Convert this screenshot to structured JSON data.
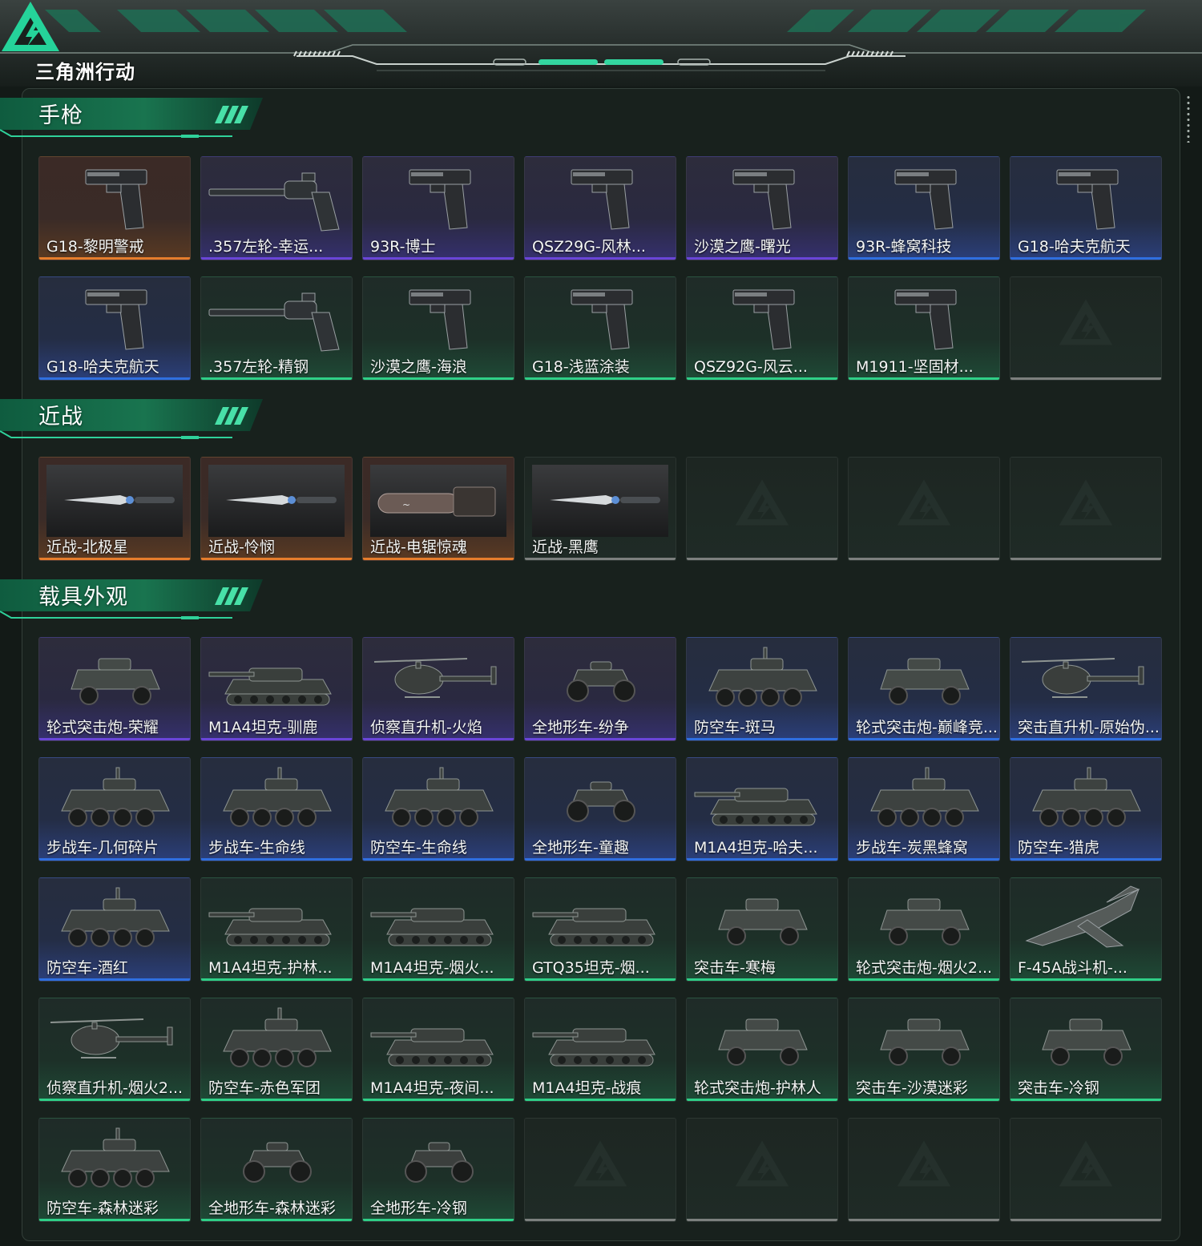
{
  "header": {
    "logo_text": "三角洲行动",
    "accent": "#2fd19a"
  },
  "sections": [
    {
      "title": "手枪",
      "cards": [
        {
          "label": "G18-黎明警戒",
          "rarity": "orange",
          "icon": "pistol-icon"
        },
        {
          "label": ".357左轮-幸运...",
          "rarity": "purple",
          "icon": "revolver-icon"
        },
        {
          "label": "93R-博士",
          "rarity": "purple",
          "icon": "pistol-icon"
        },
        {
          "label": "QSZ29G-风林...",
          "rarity": "purple",
          "icon": "pistol-icon"
        },
        {
          "label": "沙漠之鹰-曙光",
          "rarity": "purple",
          "icon": "pistol-icon"
        },
        {
          "label": "93R-蜂窝科技",
          "rarity": "blue",
          "icon": "pistol-icon"
        },
        {
          "label": "G18-哈夫克航天",
          "rarity": "blue",
          "icon": "pistol-icon"
        },
        {
          "label": "G18-哈夫克航天",
          "rarity": "blue",
          "icon": "pistol-icon"
        },
        {
          "label": ".357左轮-精钢",
          "rarity": "green",
          "icon": "revolver-icon"
        },
        {
          "label": "沙漠之鹰-海浪",
          "rarity": "green",
          "icon": "pistol-icon"
        },
        {
          "label": "G18-浅蓝涂装",
          "rarity": "green",
          "icon": "pistol-icon"
        },
        {
          "label": "QSZ92G-风云...",
          "rarity": "green",
          "icon": "pistol-icon"
        },
        {
          "label": "M1911-坚固材...",
          "rarity": "green",
          "icon": "pistol-icon"
        },
        {
          "label": "",
          "rarity": "empty",
          "icon": "empty-slot-icon"
        }
      ]
    },
    {
      "title": "近战",
      "cards": [
        {
          "label": "近战-北极星",
          "rarity": "orange",
          "icon": "knife-icon"
        },
        {
          "label": "近战-怜悯",
          "rarity": "orange",
          "icon": "knife-icon"
        },
        {
          "label": "近战-电锯惊魂",
          "rarity": "orange",
          "icon": "chainsaw-icon"
        },
        {
          "label": "近战-黑鹰",
          "rarity": "empty",
          "icon": "knife-icon"
        },
        {
          "label": "",
          "rarity": "empty",
          "icon": "empty-slot-icon"
        },
        {
          "label": "",
          "rarity": "empty",
          "icon": "empty-slot-icon"
        },
        {
          "label": "",
          "rarity": "empty",
          "icon": "empty-slot-icon"
        }
      ]
    },
    {
      "title": "载具外观",
      "cards": [
        {
          "label": "轮式突击炮-荣耀",
          "rarity": "purple",
          "icon": "wheeled-vehicle-icon"
        },
        {
          "label": "M1A4坦克-驯鹿",
          "rarity": "purple",
          "icon": "tank-icon"
        },
        {
          "label": "侦察直升机-火焰",
          "rarity": "purple",
          "icon": "helicopter-icon"
        },
        {
          "label": "全地形车-纷争",
          "rarity": "purple",
          "icon": "atv-icon"
        },
        {
          "label": "防空车-斑马",
          "rarity": "blue",
          "icon": "apc-icon"
        },
        {
          "label": "轮式突击炮-巅峰竞...",
          "rarity": "blue",
          "icon": "wheeled-vehicle-icon"
        },
        {
          "label": "突击直升机-原始伪...",
          "rarity": "blue",
          "icon": "helicopter-icon"
        },
        {
          "label": "步战车-几何碎片",
          "rarity": "blue",
          "icon": "apc-icon"
        },
        {
          "label": "步战车-生命线",
          "rarity": "blue",
          "icon": "apc-icon"
        },
        {
          "label": "防空车-生命线",
          "rarity": "blue",
          "icon": "apc-icon"
        },
        {
          "label": "全地形车-童趣",
          "rarity": "blue",
          "icon": "atv-icon"
        },
        {
          "label": "M1A4坦克-哈夫...",
          "rarity": "blue",
          "icon": "tank-icon"
        },
        {
          "label": "步战车-炭黑蜂窝",
          "rarity": "blue",
          "icon": "apc-icon"
        },
        {
          "label": "防空车-猎虎",
          "rarity": "blue",
          "icon": "apc-icon"
        },
        {
          "label": "防空车-酒红",
          "rarity": "blue",
          "icon": "apc-icon"
        },
        {
          "label": "M1A4坦克-护林...",
          "rarity": "green",
          "icon": "tank-icon"
        },
        {
          "label": "M1A4坦克-烟火...",
          "rarity": "green",
          "icon": "tank-icon"
        },
        {
          "label": "GTQ35坦克-烟...",
          "rarity": "green",
          "icon": "tank-icon"
        },
        {
          "label": "突击车-寒梅",
          "rarity": "green",
          "icon": "wheeled-vehicle-icon"
        },
        {
          "label": "轮式突击炮-烟火2...",
          "rarity": "green",
          "icon": "wheeled-vehicle-icon"
        },
        {
          "label": "F-45A战斗机-...",
          "rarity": "green",
          "icon": "jet-icon"
        },
        {
          "label": "侦察直升机-烟火2...",
          "rarity": "green",
          "icon": "helicopter-icon"
        },
        {
          "label": "防空车-赤色军团",
          "rarity": "green",
          "icon": "apc-icon"
        },
        {
          "label": "M1A4坦克-夜间...",
          "rarity": "green",
          "icon": "tank-icon"
        },
        {
          "label": "M1A4坦克-战痕",
          "rarity": "green",
          "icon": "tank-icon"
        },
        {
          "label": "轮式突击炮-护林人",
          "rarity": "green",
          "icon": "wheeled-vehicle-icon"
        },
        {
          "label": "突击车-沙漠迷彩",
          "rarity": "green",
          "icon": "wheeled-vehicle-icon"
        },
        {
          "label": "突击车-冷钢",
          "rarity": "green",
          "icon": "wheeled-vehicle-icon"
        },
        {
          "label": "防空车-森林迷彩",
          "rarity": "green",
          "icon": "apc-icon"
        },
        {
          "label": "全地形车-森林迷彩",
          "rarity": "green",
          "icon": "atv-icon"
        },
        {
          "label": "全地形车-冷钢",
          "rarity": "green",
          "icon": "atv-icon"
        },
        {
          "label": "",
          "rarity": "empty",
          "icon": "empty-slot-icon"
        },
        {
          "label": "",
          "rarity": "empty",
          "icon": "empty-slot-icon"
        },
        {
          "label": "",
          "rarity": "empty",
          "icon": "empty-slot-icon"
        },
        {
          "label": "",
          "rarity": "empty",
          "icon": "empty-slot-icon"
        }
      ]
    }
  ],
  "rarity_colors": {
    "orange": "#e57d2c",
    "purple": "#6a45d8",
    "blue": "#2f6fe0",
    "green": "#2fcf87",
    "empty": "#7c807e"
  }
}
